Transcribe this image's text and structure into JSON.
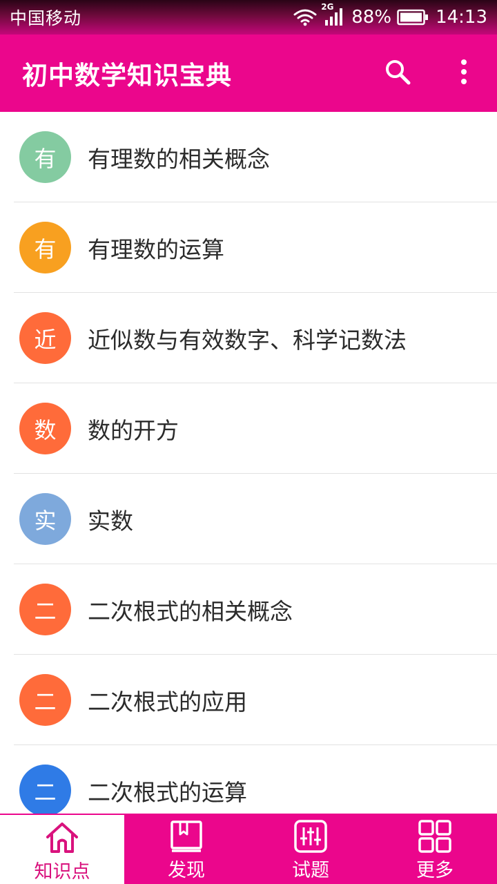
{
  "status_bar": {
    "carrier": "中国移动",
    "network": "2G",
    "battery": "88%",
    "time": "14:13"
  },
  "app_bar": {
    "title": "初中数学知识宝典",
    "search_icon": "search-icon",
    "more_icon": "more-vert-icon"
  },
  "list": {
    "items": [
      {
        "badge": "有",
        "title": "有理数的相关概念",
        "color": "#84cba1"
      },
      {
        "badge": "有",
        "title": "有理数的运算",
        "color": "#f8a020"
      },
      {
        "badge": "近",
        "title": "近似数与有效数字、科学记数法",
        "color": "#ff6b3a"
      },
      {
        "badge": "数",
        "title": "数的开方",
        "color": "#ff6b3a"
      },
      {
        "badge": "实",
        "title": "实数",
        "color": "#7ea9dc"
      },
      {
        "badge": "二",
        "title": "二次根式的相关概念",
        "color": "#ff6b3a"
      },
      {
        "badge": "二",
        "title": "二次根式的应用",
        "color": "#ff6b3a"
      },
      {
        "badge": "二",
        "title": "二次根式的运算",
        "color": "#2f7be6"
      }
    ]
  },
  "bottom_nav": {
    "items": [
      {
        "label": "知识点",
        "icon": "home-icon",
        "active": true
      },
      {
        "label": "发现",
        "icon": "book-icon",
        "active": false
      },
      {
        "label": "试题",
        "icon": "sliders-icon",
        "active": false
      },
      {
        "label": "更多",
        "icon": "grid-icon",
        "active": false
      }
    ]
  },
  "colors": {
    "accent": "#eb068c",
    "active_nav_text": "#d9127d"
  }
}
